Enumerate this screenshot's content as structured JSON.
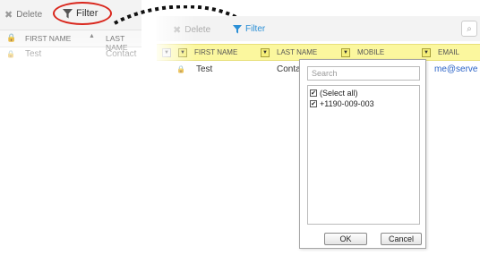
{
  "colors": {
    "accent": "#2b8fd6",
    "header_highlight": "#fbf79e",
    "annotation": "#d9261c"
  },
  "left": {
    "toolbar": {
      "delete_label": "Delete",
      "filter_label": "Filter"
    },
    "columns": [
      "FIRST NAME",
      "LAST NAME"
    ],
    "row": {
      "first_name": "Test",
      "last_name": "Contact"
    }
  },
  "right": {
    "toolbar": {
      "delete_label": "Delete",
      "filter_label": "Filter"
    },
    "columns": [
      "FIRST NAME",
      "LAST NAME",
      "MOBILE",
      "EMAIL"
    ],
    "row": {
      "first_name": "Test",
      "last_name": "Conta",
      "email": "me@serve"
    }
  },
  "filter_popup": {
    "search_placeholder": "Search",
    "options": [
      {
        "label": "(Select all)",
        "checked": true
      },
      {
        "label": "+1190-009-003",
        "checked": true
      }
    ],
    "ok_label": "OK",
    "cancel_label": "Cancel"
  }
}
